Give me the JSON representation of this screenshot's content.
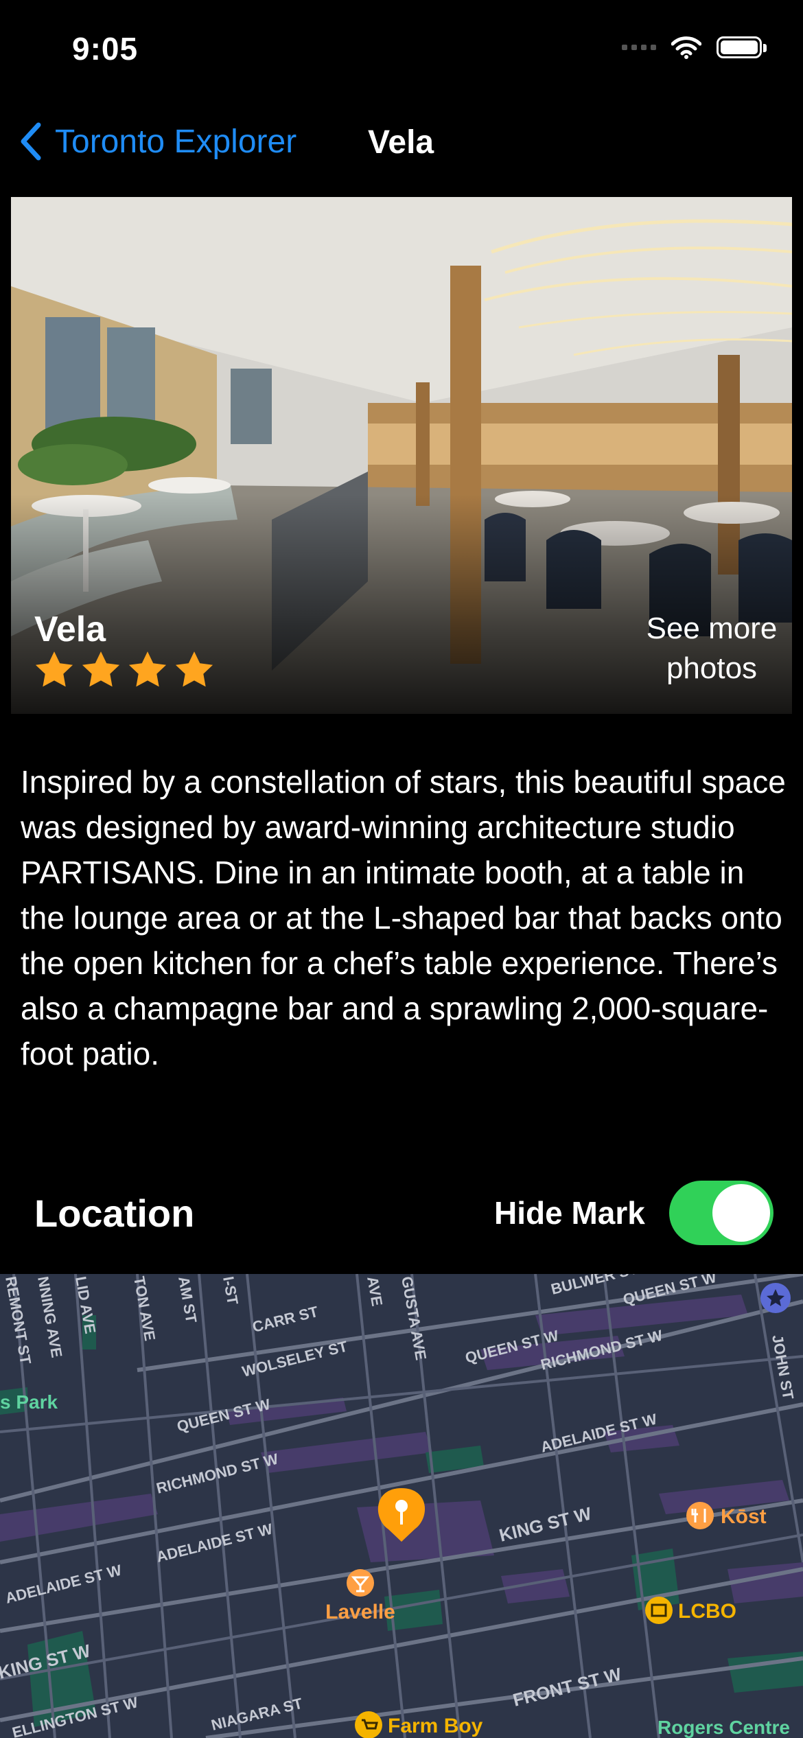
{
  "status_bar": {
    "time": "9:05"
  },
  "nav": {
    "back_label": "Toronto Explorer",
    "title": "Vela"
  },
  "hero": {
    "name": "Vela",
    "rating": 4,
    "max_rating": 4,
    "see_more": "See more\nphotos"
  },
  "description": "Inspired by a constellation of stars, this beautiful space was designed by award-winning architecture studio PARTISANS. Dine in an intimate booth, at a table in the lounge area or at the L-shaped bar that backs onto the open kitchen for a chef’s table experience. There’s also a champagne bar and a sprawling 2,000-square-foot patio.",
  "location": {
    "title": "Location",
    "hide_label": "Hide Mark",
    "hide_mark_on": true
  },
  "map": {
    "streets": {
      "queen1": "QUEEN ST W",
      "queen2": "QUEEN ST W",
      "queen3": "QUEEN ST W",
      "richmond1": "RICHMOND ST W",
      "richmond2": "RICHMOND ST W",
      "adelaide1": "ADELAIDE ST W",
      "adelaide2": "ADELAIDE ST W",
      "adelaide3": "ADELAIDE ST W",
      "king1": "KING ST W",
      "king2": "KING ST W",
      "front": "FRONT ST W",
      "carr": "CARR ST",
      "wolseley": "WOLSELEY ST",
      "bulwer": "BULWER ST",
      "niagara": "NIAGARA ST",
      "wellington": "ELLINGTON ST W",
      "john": "JOHN ST",
      "gusta": "GUSTA AVE",
      "ave": "AVE",
      "st": "I-ST",
      "amst": "AM ST",
      "tonave": "TON AVE",
      "lidave": "LID AVE",
      "nningave": "NNING AVE",
      "remont": "REMONT ST"
    },
    "places": {
      "park": "s Park",
      "lavelle": "Lavelle",
      "kost": "Kōst",
      "lcbo": "LCBO",
      "farmboy": "Farm Boy",
      "rogers": "Rogers Centre"
    }
  },
  "colors": {
    "accent": "#1f8cf5",
    "star": "#ffa51f",
    "toggle": "#30d158",
    "pin": "#ff9f0a",
    "map_bg": "#2d3548"
  }
}
